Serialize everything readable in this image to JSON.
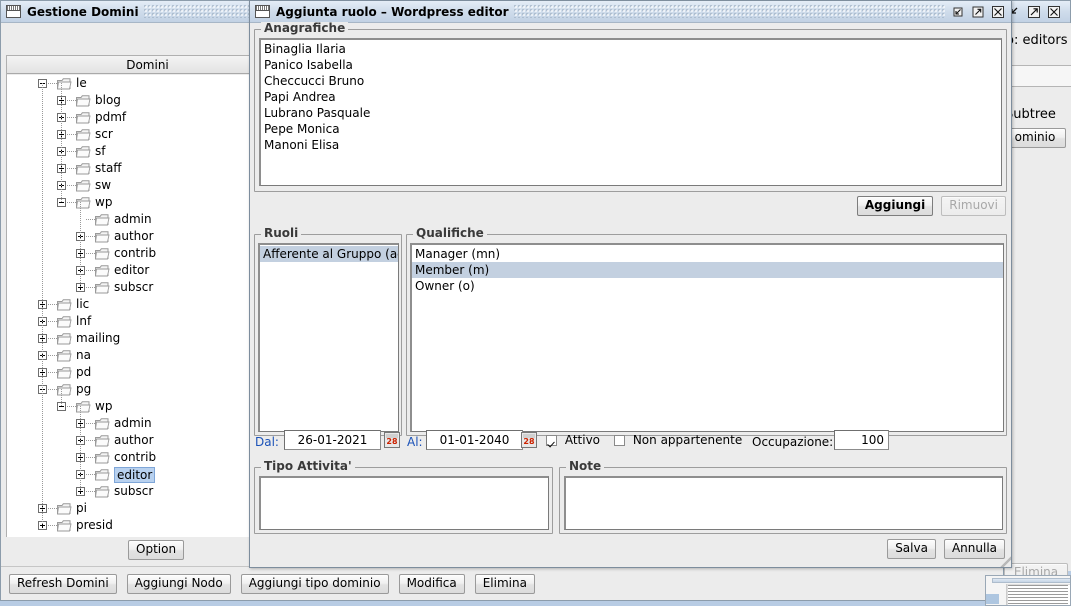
{
  "desktop": {
    "background_color": "#b8cce4"
  },
  "main_window": {
    "title": "Gestione Domini",
    "icon": "window-icon",
    "tree_header": "Domini",
    "option_button": "Option",
    "toolbar_buttons": [
      "Refresh Domini",
      "Aggiungi Nodo",
      "Aggiungi tipo dominio",
      "Modifica",
      "Elimina"
    ],
    "tree": [
      {
        "label": "le",
        "depth": 0,
        "state": "expanded",
        "selected": false
      },
      {
        "label": "blog",
        "depth": 1,
        "state": "collapsed",
        "selected": false
      },
      {
        "label": "pdmf",
        "depth": 1,
        "state": "collapsed",
        "selected": false
      },
      {
        "label": "scr",
        "depth": 1,
        "state": "collapsed",
        "selected": false
      },
      {
        "label": "sf",
        "depth": 1,
        "state": "collapsed",
        "selected": false
      },
      {
        "label": "staff",
        "depth": 1,
        "state": "collapsed",
        "selected": false
      },
      {
        "label": "sw",
        "depth": 1,
        "state": "collapsed",
        "selected": false
      },
      {
        "label": "wp",
        "depth": 1,
        "state": "expanded",
        "selected": false
      },
      {
        "label": "admin",
        "depth": 2,
        "state": "leaf",
        "selected": false
      },
      {
        "label": "author",
        "depth": 2,
        "state": "collapsed",
        "selected": false
      },
      {
        "label": "contrib",
        "depth": 2,
        "state": "collapsed",
        "selected": false
      },
      {
        "label": "editor",
        "depth": 2,
        "state": "collapsed",
        "selected": false
      },
      {
        "label": "subscr",
        "depth": 2,
        "state": "collapsed",
        "selected": false
      },
      {
        "label": "lic",
        "depth": 0,
        "state": "collapsed",
        "selected": false
      },
      {
        "label": "lnf",
        "depth": 0,
        "state": "collapsed",
        "selected": false
      },
      {
        "label": "mailing",
        "depth": 0,
        "state": "collapsed",
        "selected": false
      },
      {
        "label": "na",
        "depth": 0,
        "state": "collapsed",
        "selected": false
      },
      {
        "label": "pd",
        "depth": 0,
        "state": "collapsed",
        "selected": false
      },
      {
        "label": "pg",
        "depth": 0,
        "state": "expanded",
        "selected": false
      },
      {
        "label": "wp",
        "depth": 1,
        "state": "expanded",
        "selected": false
      },
      {
        "label": "admin",
        "depth": 2,
        "state": "collapsed",
        "selected": false
      },
      {
        "label": "author",
        "depth": 2,
        "state": "collapsed",
        "selected": false
      },
      {
        "label": "contrib",
        "depth": 2,
        "state": "collapsed",
        "selected": false
      },
      {
        "label": "editor",
        "depth": 2,
        "state": "collapsed",
        "selected": true
      },
      {
        "label": "subscr",
        "depth": 2,
        "state": "collapsed",
        "selected": false
      },
      {
        "label": "pi",
        "depth": 0,
        "state": "collapsed",
        "selected": false
      },
      {
        "label": "presid",
        "depth": 0,
        "state": "collapsed",
        "selected": false
      }
    ]
  },
  "background_window": {
    "header_text": "o: editors",
    "subtree_text": "Subtree",
    "dominio_button": "ominio",
    "elimina_button": "Elimina"
  },
  "dialog": {
    "title": "Aggiunta ruolo – Wordpress editor",
    "icon": "window-icon",
    "window_buttons": [
      "restore-icon",
      "maximize-icon",
      "close-icon"
    ],
    "anagrafiche": {
      "legend": "Anagrafiche",
      "items": [
        "Binaglia Ilaria",
        "Panico Isabella",
        "Checcucci Bruno",
        "Papi Andrea",
        "Lubrano Pasquale",
        "Pepe Monica",
        "Manoni Elisa"
      ]
    },
    "add_button": "Aggiungi",
    "remove_button": "Rimuovi",
    "remove_button_disabled": true,
    "ruoli": {
      "legend": "Ruoli",
      "items": [
        {
          "label": "Afferente al Gruppo (ag)",
          "selected": true
        }
      ]
    },
    "qualifiche": {
      "legend": "Qualifiche",
      "items": [
        {
          "label": "Manager (mn)",
          "selected": false
        },
        {
          "label": "Member (m)",
          "selected": true
        },
        {
          "label": "Owner (o)",
          "selected": false
        }
      ]
    },
    "dates": {
      "from_label": "Dal:",
      "from_value": "26-01-2021",
      "to_label": "Al:",
      "to_value": "01-01-2040",
      "calendar_icon_day": "28"
    },
    "attivo": {
      "label": "Attivo",
      "checked": true
    },
    "non_appartenente": {
      "label": "Non appartenente",
      "checked": false
    },
    "occupazione": {
      "label": "Occupazione:",
      "value": "100"
    },
    "tipo_attivita": {
      "legend": "Tipo Attivita'",
      "value": ""
    },
    "note": {
      "legend": "Note",
      "value": ""
    },
    "save_button": "Salva",
    "cancel_button": "Annulla",
    "colors": {
      "title_bar": "#cfdceb",
      "panel": "#ececec",
      "selection": "#c3d0e0",
      "tree_selection": "#b8d1ef",
      "date_label": "#1b52b8",
      "calendar_day": "#cc2200"
    }
  }
}
